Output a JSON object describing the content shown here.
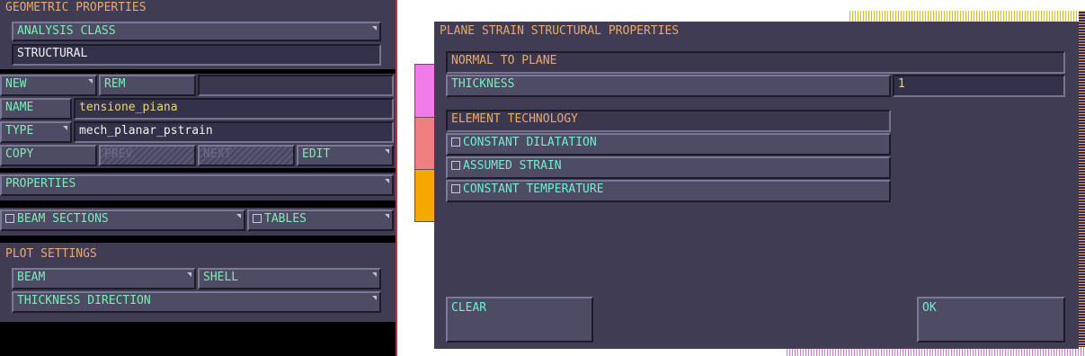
{
  "left_panel": {
    "title": "GEOMETRIC PROPERTIES",
    "analysis_class_label": "ANALYSIS CLASS",
    "analysis_class_value": "STRUCTURAL",
    "new_label": "NEW",
    "rem_label": "REM",
    "name_label": "NAME",
    "name_value": "tensione_piana",
    "type_label": "TYPE",
    "type_value": "mech_planar_pstrain",
    "copy_label": "COPY",
    "prev_label": "PREV",
    "next_label": "NEXT",
    "edit_label": "EDIT",
    "properties_label": "PROPERTIES",
    "beam_sections_label": "BEAM SECTIONS",
    "tables_label": "TABLES",
    "plot_settings_title": "PLOT SETTINGS",
    "beam_label": "BEAM",
    "shell_label": "SHELL",
    "thickness_direction_label": "THICKNESS DIRECTION"
  },
  "dialog": {
    "title": "PLANE STRAIN STRUCTURAL PROPERTIES",
    "normal_to_plane": "NORMAL TO PLANE",
    "thickness_label": "THICKNESS",
    "thickness_value": "1",
    "element_technology": "ELEMENT TECHNOLOGY",
    "options": [
      "CONSTANT DILATATION",
      "ASSUMED STRAIN",
      "CONSTANT TEMPERATURE"
    ],
    "clear_label": "CLEAR",
    "ok_label": "OK"
  },
  "colors": {
    "panel_bg": "#3f3c53",
    "header_orange": "#e8a96c",
    "text_yellow": "#e9d771",
    "text_green": "#78f0b4",
    "swatches": [
      "#f07ae8",
      "#f08080",
      "#f5a800"
    ]
  }
}
